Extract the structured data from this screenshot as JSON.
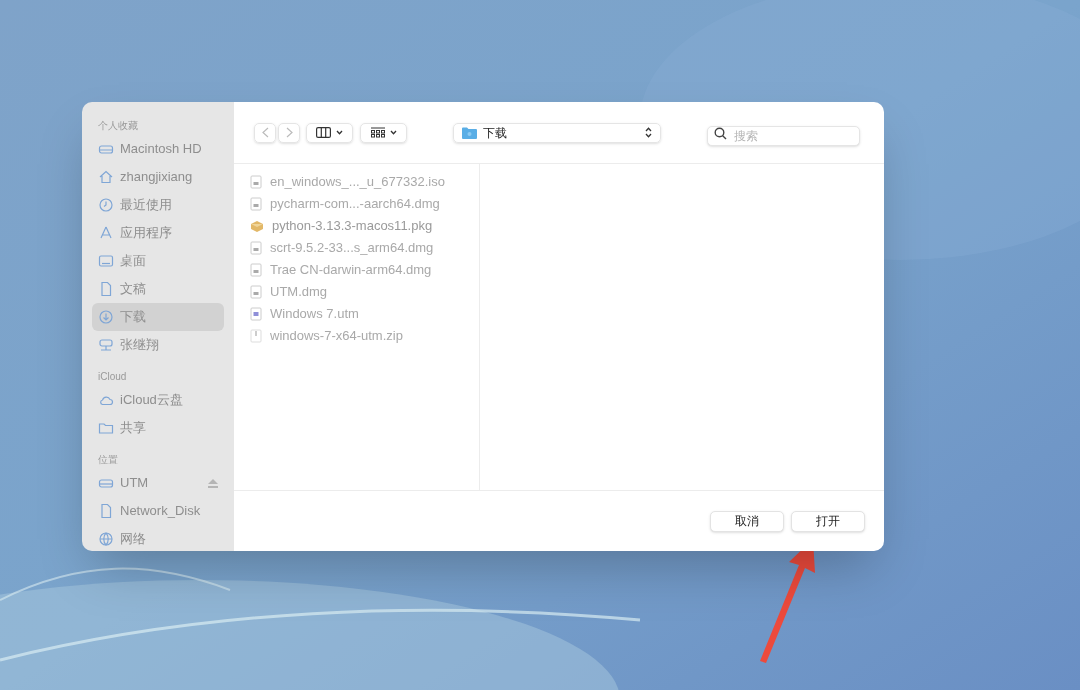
{
  "sidebar": {
    "sections": [
      {
        "title": "个人收藏",
        "items": [
          {
            "label": "Macintosh HD",
            "selected": false
          },
          {
            "label": "zhangjixiang",
            "selected": false
          },
          {
            "label": "最近使用",
            "selected": false
          },
          {
            "label": "应用程序",
            "selected": false
          },
          {
            "label": "桌面",
            "selected": false
          },
          {
            "label": "文稿",
            "selected": false
          },
          {
            "label": "下载",
            "selected": true
          },
          {
            "label": "张继翔",
            "selected": false
          }
        ]
      },
      {
        "title": "iCloud",
        "items": [
          {
            "label": "iCloud云盘",
            "selected": false
          },
          {
            "label": "共享",
            "selected": false
          }
        ]
      },
      {
        "title": "位置",
        "items": [
          {
            "label": "UTM",
            "selected": false,
            "eject": true
          },
          {
            "label": "Network_Disk",
            "selected": false,
            "eject": false
          },
          {
            "label": "网络",
            "selected": false,
            "eject": false
          }
        ]
      }
    ]
  },
  "toolbar": {
    "location": "下载",
    "search": {
      "placeholder": "搜索"
    }
  },
  "files": [
    {
      "name": "en_windows_..._u_677332.iso",
      "disabled": true
    },
    {
      "name": "pycharm-com...-aarch64.dmg",
      "disabled": true
    },
    {
      "name": "python-3.13.3-macos11.pkg",
      "disabled": false
    },
    {
      "name": "scrt-9.5.2-33...s_arm64.dmg",
      "disabled": true
    },
    {
      "name": "Trae CN-darwin-arm64.dmg",
      "disabled": true
    },
    {
      "name": "UTM.dmg",
      "disabled": true
    },
    {
      "name": "Windows 7.utm",
      "disabled": true
    },
    {
      "name": "windows-7-x64-utm.zip",
      "disabled": true
    }
  ],
  "buttons": [
    {
      "label": "取消"
    },
    {
      "label": "打开"
    }
  ]
}
